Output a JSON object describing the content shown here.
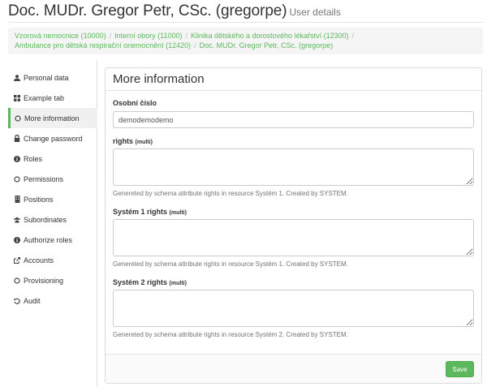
{
  "header": {
    "title": "Doc. MUDr. Gregor Petr, CSc. (gregorpe)",
    "subtitle": "User details"
  },
  "breadcrumb": [
    "Vzorová nemocnice (10000)",
    "Interní obory (11000)",
    "Klinika dětského a dorostového lékařství (12300)",
    "Ambulance pro dětská respirační onemocnění (12420)",
    "Doc. MUDr. Gregor Petr, CSc. (gregorpe)"
  ],
  "sidebar": {
    "items": [
      {
        "label": "Personal data",
        "icon": "user-icon"
      },
      {
        "label": "Example tab",
        "icon": "grid-icon"
      },
      {
        "label": "More information",
        "icon": "circle-icon"
      },
      {
        "label": "Change password",
        "icon": "lock-icon"
      },
      {
        "label": "Roles",
        "icon": "info-icon"
      },
      {
        "label": "Permissions",
        "icon": "circle-icon"
      },
      {
        "label": "Positions",
        "icon": "building-icon"
      },
      {
        "label": "Subordinates",
        "icon": "users-icon"
      },
      {
        "label": "Authorize roles",
        "icon": "info-icon"
      },
      {
        "label": "Accounts",
        "icon": "external-link-icon"
      },
      {
        "label": "Provisioning",
        "icon": "circle-icon"
      },
      {
        "label": "Audit",
        "icon": "undo-icon"
      }
    ],
    "active_index": 2
  },
  "panel": {
    "title": "More information",
    "fields": [
      {
        "label": "Osobní číslo",
        "multi": "",
        "type": "input",
        "value": "demodemodemo",
        "help": ""
      },
      {
        "label": "rights",
        "multi": "(multi)",
        "type": "textarea",
        "value": "",
        "help": "Genereted by schema attribute rights in resource Systém 1. Created by SYSTEM."
      },
      {
        "label": "Systém 1 rights",
        "multi": "(multi)",
        "type": "textarea",
        "value": "",
        "help": "Genereted by schema attribute rights in resource Systém 1. Created by SYSTEM."
      },
      {
        "label": "Systém 2 rights",
        "multi": "(multi)",
        "type": "textarea",
        "value": "",
        "help": "Genereted by schema attribute rights in resource Systém 2. Created by SYSTEM."
      }
    ],
    "save_label": "Save"
  },
  "colors": {
    "accent": "#5cb85c",
    "link": "#5cb85c",
    "muted": "#777777"
  }
}
